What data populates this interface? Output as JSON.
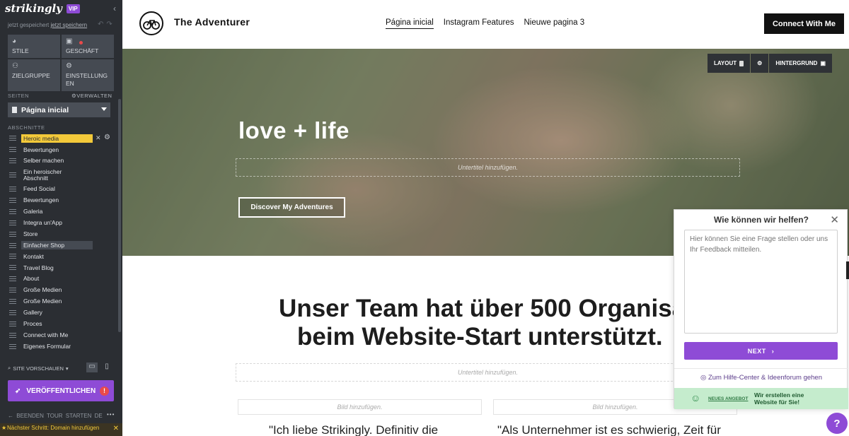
{
  "sidebar": {
    "logo": "strikingly",
    "vip": "VIP",
    "saved_text": "jetzt gespeichert",
    "save_link": "jetzt speichern",
    "grid": [
      {
        "label": "STILE",
        "icon": "palette-icon"
      },
      {
        "label": "GESCHÄFT",
        "icon": "shopping-bag-icon"
      },
      {
        "label": "ZIELGRUPPE",
        "icon": "people-icon"
      },
      {
        "label": "EINSTELLUNG\nEN",
        "icon": "gear-icon"
      }
    ],
    "pages_heading": "SEITEN",
    "manage_label": "VERWALTEN",
    "current_page": "Página inicial",
    "sections_heading": "ABSCHNITTE",
    "sections": [
      "Heroic media",
      "Bewertungen",
      "Selber machen",
      "Ein heroischer Abschnitt",
      "Feed Social",
      "Bewertungen",
      "Galeria",
      "Integra un'App",
      "Store",
      "Einfacher Shop",
      "Kontakt",
      "Travel Blog",
      "About",
      "Große Medien",
      "Große Medien",
      "Gallery",
      "Proces",
      "Connect with Me",
      "Eigenes Formular"
    ],
    "preview_label": "SITE VORSCHAUEN",
    "publish_label": "VERÖFFENTLICHEN",
    "publish_warning": "!",
    "tour": {
      "end": "BEENDEN",
      "start": "TOUR STARTEN",
      "lang": "DE",
      "more": "•••"
    },
    "next_step": "Nächster Schritt: Domain hinzufügen"
  },
  "header": {
    "site_title": "The Adventurer",
    "nav": [
      "Página inicial",
      "Instagram Features",
      "Nieuwe pagina 3"
    ],
    "cta": "Connect With Me"
  },
  "hero": {
    "title": "love + life",
    "subtitle_placeholder": "Untertitel hinzufügen.",
    "button": "Discover My Adventures",
    "tools": {
      "layout": "LAYOUT",
      "background": "HINTERGRUND"
    }
  },
  "content": {
    "headline_1": "Unser Team hat über 500 Organisatio",
    "headline_2": "beim Website-Start unterstützt.",
    "subtitle_placeholder": "Untertitel hinzufügen.",
    "image_placeholder": "Bild hinzufügen.",
    "quote_1": "\"Ich liebe Strikingly. Definitiv die",
    "quote_2": "\"Als Unternehmer ist es schwierig, Zeit für"
  },
  "help": {
    "title": "Wie können wir helfen?",
    "placeholder": "Hier können Sie eine Frage stellen oder uns Ihr Feedback mitteilen.",
    "next": "NEXT",
    "help_center": "Zum Hilfe-Center & Ideenforum gehen",
    "offer_tag": "NEUES ANGEBOT",
    "offer_text": "Wir erstellen eine Website für Sie!",
    "fab": "?"
  },
  "colors": {
    "accent": "#8e4bd6",
    "highlight": "#f3c93a",
    "sidebar": "#2b2e33"
  }
}
